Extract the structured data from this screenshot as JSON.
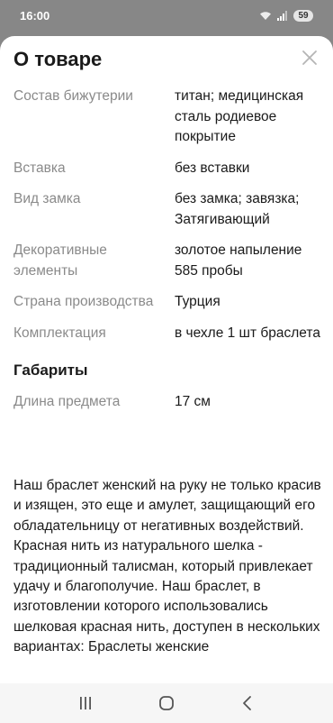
{
  "status_bar": {
    "time": "16:00",
    "battery": "59",
    "icons": [
      "wifi-icon",
      "signal-icon",
      "battery-icon"
    ]
  },
  "sheet": {
    "title": "О товаре",
    "close_icon": "close-icon"
  },
  "properties": [
    {
      "key": "Состав бижутерии",
      "value": "титан; медицинская сталь родиевое покрытие"
    },
    {
      "key": "Вставка",
      "value": "без вставки"
    },
    {
      "key": "Вид замка",
      "value": "без замка; завязка; Затягивающий"
    },
    {
      "key": "Декоративные элементы",
      "value": "золотое напыление 585 пробы"
    },
    {
      "key": "Страна производства",
      "value": "Турция"
    },
    {
      "key": "Комплектация",
      "value": "в чехле 1 шт браслета"
    }
  ],
  "dimensions": {
    "title": "Габариты",
    "items": [
      {
        "key": "Длина предмета",
        "value": "17 см"
      }
    ]
  },
  "description": " Наш браслет женский на руку не только красив и изящен, это еще и амулет, защищающий его обладательницу от негативных воздействий. Красная нить из натурального шелка - традиционный талисман, который привлекает удачу и благополучие. Наш браслет, в изготовлении которого использовались шелковая красная нить, доступен в нескольких вариантах: Браслеты женские",
  "nav_bar": {
    "icons": [
      "recent-apps-icon",
      "home-icon",
      "back-icon"
    ]
  },
  "colors": {
    "label": "#8a8a8a",
    "text": "#1a1a1a",
    "background": "#ffffff",
    "overlay": "#878787"
  }
}
